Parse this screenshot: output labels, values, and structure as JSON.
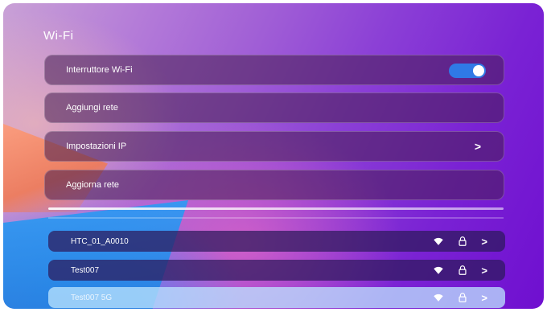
{
  "screen": {
    "title": "Wi-Fi"
  },
  "settings": [
    {
      "label": "Interruttore Wi-Fi",
      "toggle_on": true
    },
    {
      "label": "Aggiungi rete"
    },
    {
      "label": "Impostazioni IP",
      "chevron": ">"
    },
    {
      "label": "Aggiorna rete"
    }
  ],
  "networks": [
    {
      "ssid": "HTC_01_A0010"
    },
    {
      "ssid": "Test007"
    },
    {
      "ssid": "Test007 5G"
    }
  ],
  "icons": {
    "wifi": "wifi-icon",
    "lock": "lock-icon",
    "chevron": "chevron-right-icon"
  },
  "chevron_glyph": ">",
  "colors": {
    "toggle_on": "#2f79e6",
    "accent_purple": "#7a22d4"
  }
}
